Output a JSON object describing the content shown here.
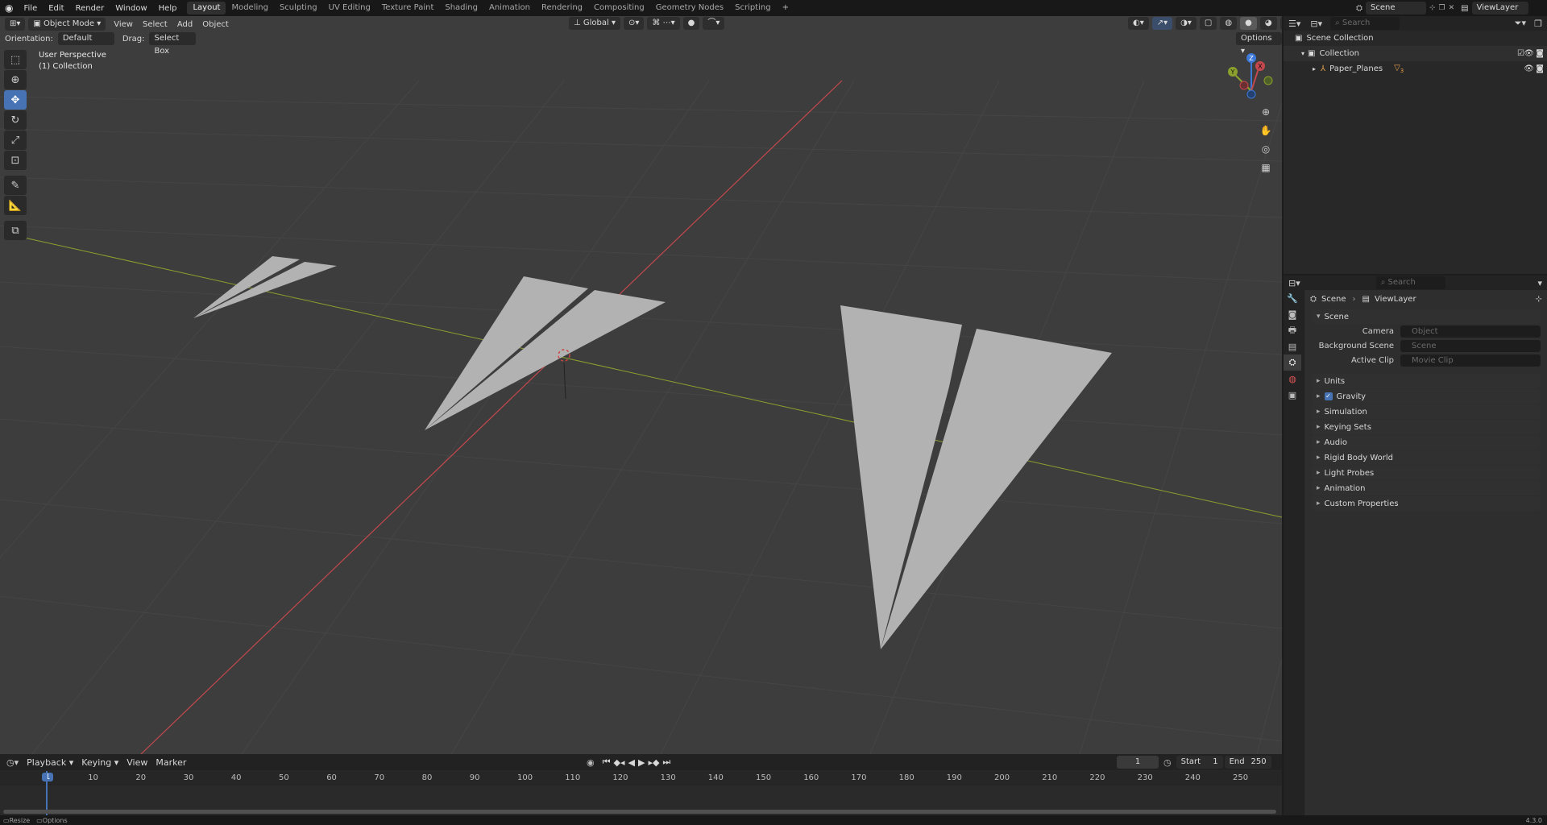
{
  "top_menu": [
    "File",
    "Edit",
    "Render",
    "Window",
    "Help"
  ],
  "workspaces": [
    "Layout",
    "Modeling",
    "Sculpting",
    "UV Editing",
    "Texture Paint",
    "Shading",
    "Animation",
    "Rendering",
    "Compositing",
    "Geometry Nodes",
    "Scripting"
  ],
  "active_workspace": "Layout",
  "scene_field": "Scene",
  "viewlayer_field": "ViewLayer",
  "viewport": {
    "mode": "Object Mode",
    "menus": [
      "View",
      "Select",
      "Add",
      "Object"
    ],
    "transform_orientation": "Global",
    "orientation_label": "Orientation:",
    "orientation_value": "Default",
    "drag_label": "Drag:",
    "drag_value": "Select Box",
    "options_label": "Options",
    "overlay_line1": "User Perspective",
    "overlay_line2": "(1) Collection",
    "gizmo": {
      "x": "X",
      "y": "Y",
      "z": "Z"
    }
  },
  "timeline": {
    "menus": [
      "Playback",
      "Keying",
      "View",
      "Marker"
    ],
    "current_frame": "1",
    "start_label": "Start",
    "start_value": "1",
    "end_label": "End",
    "end_value": "250",
    "ruler": [
      "1",
      "10",
      "20",
      "30",
      "40",
      "50",
      "60",
      "70",
      "80",
      "90",
      "100",
      "110",
      "120",
      "130",
      "140",
      "150",
      "160",
      "170",
      "180",
      "190",
      "200",
      "210",
      "220",
      "230",
      "240",
      "250"
    ]
  },
  "statusbar": {
    "left1": "Resize",
    "left2": "Options",
    "version": "4.3.0"
  },
  "outliner": {
    "search_placeholder": "Search",
    "root": "Scene Collection",
    "collection": "Collection",
    "object": "Paper_Planes",
    "object_badge": "3"
  },
  "properties": {
    "search_placeholder": "Search",
    "breadcrumb_scene": "Scene",
    "breadcrumb_viewlayer": "ViewLayer",
    "panel_title": "Scene",
    "fields": [
      {
        "label": "Camera",
        "placeholder": "Object"
      },
      {
        "label": "Background Scene",
        "placeholder": "Scene"
      },
      {
        "label": "Active Clip",
        "placeholder": "Movie Clip"
      }
    ],
    "sections": [
      "Units",
      "Gravity",
      "Simulation",
      "Keying Sets",
      "Audio",
      "Rigid Body World",
      "Light Probes",
      "Animation",
      "Custom Properties"
    ],
    "gravity_checked": true
  },
  "colors": {
    "accent": "#4772b3",
    "x_axis": "#c4484d",
    "y_axis": "#8ba12d",
    "z_axis": "#3c78d8",
    "plane": "#b2b2b2"
  }
}
